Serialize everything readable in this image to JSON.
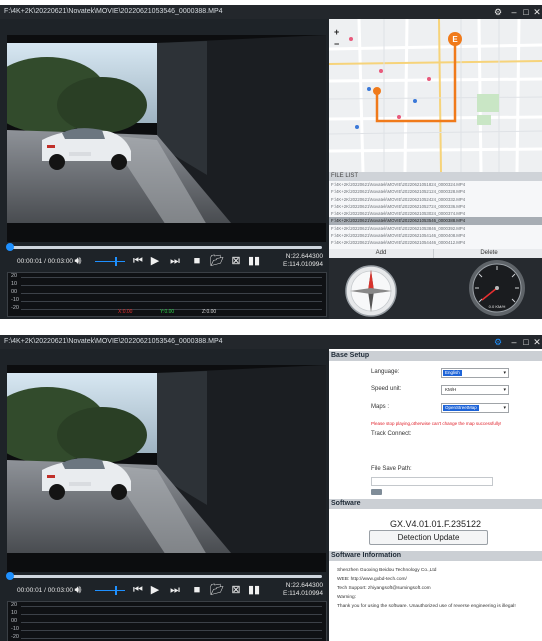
{
  "top": {
    "title": "F:\\4K+2K\\20220621\\Novatek\\MOVIE\\20220621053546_0000388.MP4",
    "current_time": "00:00:01",
    "total_time": "00:03:00",
    "time_separator": "/",
    "position_fraction": 0.01,
    "lat": "N:22.644300",
    "lon": "E:114.010994",
    "graph_y_labels": [
      "20",
      "10",
      "00",
      "-10",
      "-20"
    ],
    "legend": [
      {
        "label": "X:0.00",
        "color": "#e83030"
      },
      {
        "label": "Y:0.00",
        "color": "#2fd04a"
      },
      {
        "label": "Z:0.00",
        "color": "#d8d8d8"
      }
    ],
    "zoom_in": "+",
    "zoom_out": "−",
    "map_end_marker": "E",
    "file_list_header": "FILE LIST",
    "files": [
      "F:\\4K+2K\\20220621\\Novatek\\MOVIE\\20220621051824_0000324.MP4",
      "F:\\4K+2K\\20220621\\Novatek\\MOVIE\\20220621052124_0000328.MP4",
      "F:\\4K+2K\\20220621\\Novatek\\MOVIE\\20220621052424_0000332.MP4",
      "F:\\4K+2K\\20220621\\Novatek\\MOVIE\\20220621052724_0000336.MP4",
      "F:\\4K+2K\\20220621\\Novatek\\MOVIE\\20220621053024_0000374.MP4",
      "F:\\4K+2K\\20220621\\Novatek\\MOVIE\\20220621053546_0000388.MP4",
      "F:\\4K+2K\\20220621\\Novatek\\MOVIE\\20220621053846_0000392.MP4",
      "F:\\4K+2K\\20220621\\Novatek\\MOVIE\\20220621054146_0000408.MP4",
      "F:\\4K+2K\\20220621\\Novatek\\MOVIE\\20220621054446_0000412.MP4"
    ],
    "selected_file_index": 5,
    "add_label": "Add",
    "delete_label": "Delete",
    "speed_readout": "0.0 KM/H"
  },
  "bottom": {
    "title": "F:\\4K+2K\\20220621\\Novatek\\MOVIE\\20220621053546_0000388.MP4",
    "current_time": "00:00:01",
    "total_time": "00:03:00",
    "time_separator": "/",
    "position_fraction": 0.01,
    "lat": "N:22.644300",
    "lon": "E:114.010994",
    "graph_y_labels": [
      "20",
      "10",
      "00",
      "-10",
      "-20"
    ],
    "base_setup_header": "Base Setup",
    "language_label": "Language:",
    "language_value": "English",
    "speed_unit_label": "Speed unit:",
    "speed_unit_value": "KM/H",
    "maps_label": "Maps :",
    "maps_value": "OpenStreetMap",
    "maps_warning": "Please stop playing,otherwise can't change the map successfully!",
    "track_connect_label": "Track Connect:",
    "file_save_path_label": "File Save Path:",
    "software_header": "Software",
    "version": "GX.V4.01.01.F.235122",
    "detection_update_label": "Detection Update",
    "software_info_header": "Software Information",
    "company": "Shenzhen Guoxing Beidou Technology Co.,Ltd",
    "web": "WEB: http://www.gxbd-tech.com/",
    "tech_support": "Tech Support: zhiyangsoft@sumingsoft.com",
    "warning_label": "Warning:",
    "thanks": "Thank you for using the software. Unauthorized use of reverse engineering is illegal!"
  },
  "colors": {
    "accent": "#1e90ff",
    "route": "#f07a1a",
    "titlebar": "#23272c",
    "background": "#1e2328"
  },
  "icons": [
    "gear-icon",
    "minimize-icon",
    "maximize-icon",
    "close-icon",
    "volume-icon",
    "skip-back-icon",
    "play-icon",
    "skip-forward-icon",
    "stop-icon",
    "folder-icon",
    "snapshot-icon",
    "fullscreen-icon"
  ]
}
